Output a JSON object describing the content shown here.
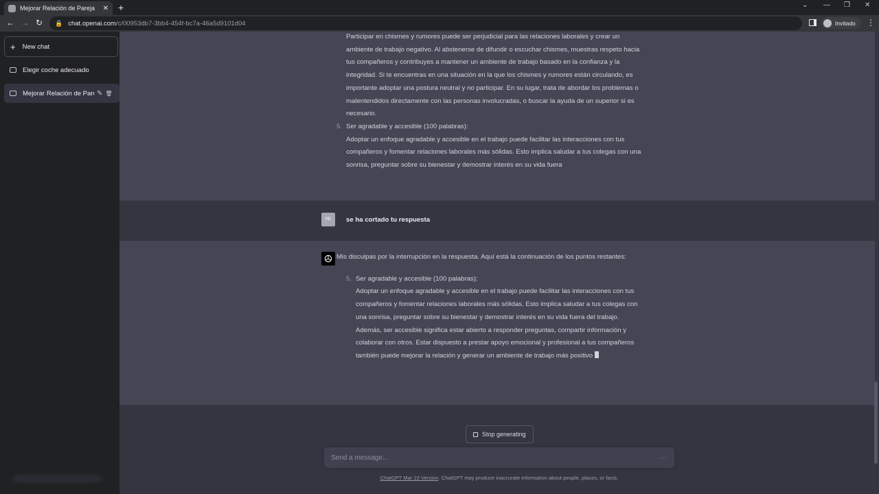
{
  "browser": {
    "tab_title": "Mejorar Relación de Pareja",
    "tab_close": "✕",
    "new_tab": "+",
    "win_minimize": "⌄",
    "win_min": "—",
    "win_restore": "❐",
    "win_close": "✕",
    "back": "←",
    "forward": "→",
    "reload": "↻",
    "url_host": "chat.openai.com",
    "url_path": "/c/00953db7-3bb4-454f-bc7a-46a5d9101d04",
    "profile_label": "Invitado",
    "menu": "⋮"
  },
  "sidebar": {
    "new_chat_icon": "+",
    "new_chat_label": "New chat",
    "conversations": [
      {
        "title": "Elegir coche adecuado",
        "active": false
      },
      {
        "title": "Mejorar Relación de Pareja",
        "active": true
      }
    ],
    "edit_icon": "✎",
    "delete_icon": "🗑"
  },
  "messages": [
    {
      "role": "assistant",
      "paragraphs": [
        "Participar en chismes y rumores puede ser perjudicial para las relaciones laborales y crear un ambiente de trabajo negativo. Al abstenerse de difundir o escuchar chismes, muestras respeto hacia tus compañeros y contribuyes a mantener un ambiente de trabajo basado en la confianza y la integridad. Si te encuentras en una situación en la que los chismes y rumores están circulando, es importante adoptar una postura neutral y no participar. En su lugar, trata de abordar los problemas o malentendidos directamente con las personas involucradas, o buscar la ayuda de un superior si es necesario."
      ],
      "list_number": "5.",
      "list_heading": "Ser agradable y accesible (100 palabras):",
      "list_body": "Adoptar un enfoque agradable y accesible en el trabajo puede facilitar las interacciones con tus compañeros y fomentar relaciones laborales más sólidas. Esto implica saludar a tus colegas con una sonrisa, preguntar sobre su bienestar y demostrar interés en su vida fuera"
    },
    {
      "role": "user",
      "avatar_text": "PE",
      "text": "se ha cortado tu respuesta"
    },
    {
      "role": "assistant",
      "intro": "Mis disculpas por la interrupción en la respuesta. Aquí está la continuación de los puntos restantes:",
      "list_number": "5.",
      "list_heading": "Ser agradable y accesible (100 palabras):",
      "list_body": "Adoptar un enfoque agradable y accesible en el trabajo puede facilitar las interacciones con tus compañeros y fomentar relaciones laborales más sólidas. Esto implica saludar a tus colegas con una sonrisa, preguntar sobre su bienestar y demostrar interés en su vida fuera del trabajo. Además, ser accesible significa estar abierto a responder preguntas, compartir información y colaborar con otros. Estar dispuesto a prestar apoyo emocional y profesional a tus compañeros también puede mejorar la relación y generar un ambiente de trabajo más positivo"
    }
  ],
  "composer": {
    "stop_label": "Stop generating",
    "placeholder": "Send a message...",
    "more": "···"
  },
  "footer": {
    "version_link": "ChatGPT Mar 23 Version",
    "disclaimer": ". ChatGPT may produce inaccurate information about people, places, or facts."
  },
  "colors": {
    "main_bg": "#343541",
    "assistant_bg": "#444654",
    "sidebar_bg": "#202123"
  }
}
